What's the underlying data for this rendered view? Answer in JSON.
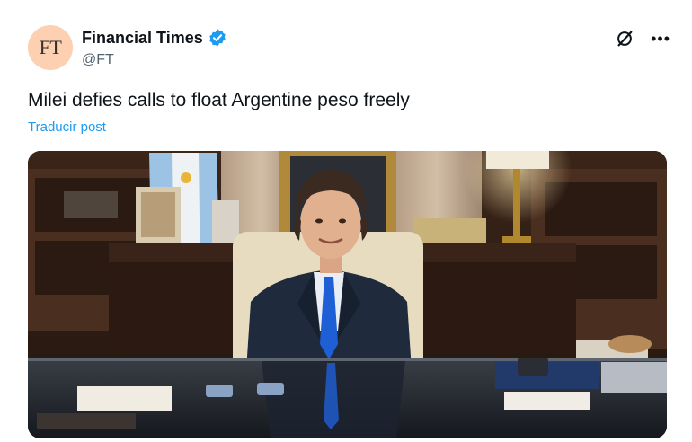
{
  "author": {
    "avatar_text": "FT",
    "display_name": "Financial Times",
    "handle": "@FT",
    "verified": true
  },
  "post": {
    "text": "Milei defies calls to float Argentine peso freely",
    "translate_label": "Traducir post"
  },
  "icons": {
    "verified": "verified-badge-icon",
    "grok": "grok-icon",
    "more": "more-options-icon"
  },
  "colors": {
    "link": "#1d9bf0",
    "verified": "#1d9bf0",
    "avatar_bg": "#fcd0b1"
  }
}
